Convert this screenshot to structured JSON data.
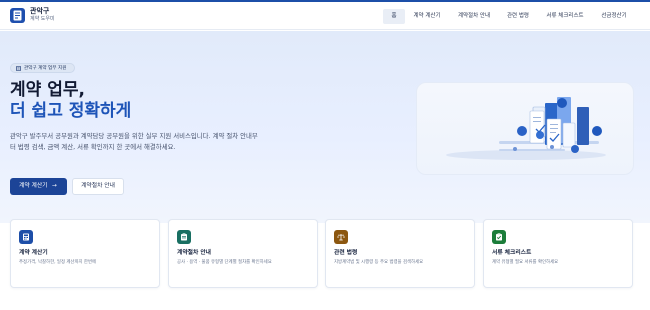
{
  "header": {
    "brand_title": "관악구",
    "brand_subtitle": "계약 도우미",
    "nav": [
      {
        "label": "홈",
        "active": true
      },
      {
        "label": "계약 계산기"
      },
      {
        "label": "계약절차 안내"
      },
      {
        "label": "관련 법령"
      },
      {
        "label": "서류 체크리스트"
      },
      {
        "label": "선금정산기"
      }
    ]
  },
  "hero": {
    "badge": "관악구 계약 업무 지원",
    "title_line1": "계약 업무,",
    "title_line2": "더 쉽고 정확하게",
    "description": "관악구 발주부서 공무원과 계약담당 공무원을 위한 실무 지원 서비스입니다. 계약 절차 안내부터 법령 검색, 금액 계산, 서류 확인까지 한 곳에서 해결하세요.",
    "primary_button": "계약 계산기",
    "primary_arrow": "→",
    "secondary_button": "계약절차 안내"
  },
  "cards": [
    {
      "title": "계약 계산기",
      "description": "추정가격, 낙찰하한, 일정 계산까지 한번에",
      "icon": "calculator-icon",
      "color": "#1d4ea8"
    },
    {
      "title": "계약절차 안내",
      "description": "공사 · 용역 · 물품 유형별 단계별 절차를 확인하세요",
      "icon": "clipboard-icon",
      "color": "#196f62"
    },
    {
      "title": "관련 법령",
      "description": "지방계약법 및 시행령 등 주요 법령을 검색하세요",
      "icon": "law-icon",
      "color": "#8c5710"
    },
    {
      "title": "서류 체크리스트",
      "description": "계약 유형별 필요 서류를 확인하세요",
      "icon": "checklist-icon",
      "color": "#1c7d3a"
    }
  ],
  "colors": {
    "accent": "#1d54b8",
    "primary_button": "#1c4497"
  }
}
